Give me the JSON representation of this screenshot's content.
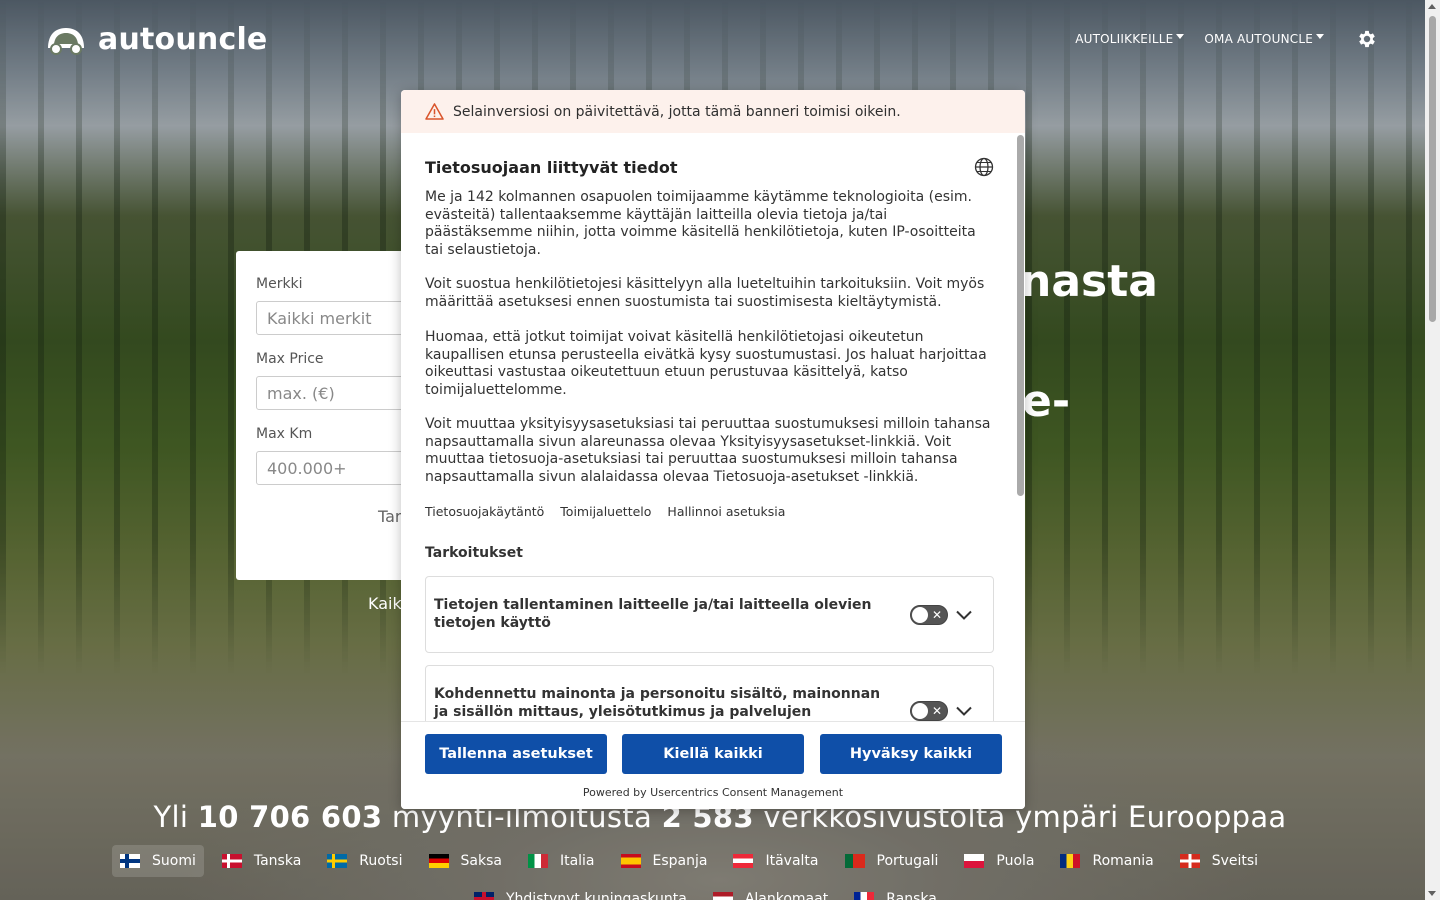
{
  "header": {
    "logo_text": "autouncle",
    "nav": [
      {
        "label": "AUTOLIIKKEILLE"
      },
      {
        "label": "OMA AUTOUNCLE"
      }
    ]
  },
  "hero": {
    "title_fragment_1": "nasta",
    "title_fragment_2": "e-"
  },
  "search": {
    "brand_label": "Merkki",
    "brand_placeholder": "Kaikki merkit",
    "price_label": "Max Price",
    "price_placeholder": "max. (€)",
    "km_label": "Max Km",
    "km_placeholder": "400.000+",
    "submit_fragment": "Tar",
    "all_link_fragment": "Kaik"
  },
  "stats": {
    "prefix": "Yli",
    "listings": "10 706 603",
    "middle": "myynti-ilmoitusta",
    "sites": "2 583",
    "suffix": "verkkosivustolta ympäri Eurooppaa"
  },
  "countries": [
    {
      "label": "Suomi",
      "flag": "fi",
      "active": true
    },
    {
      "label": "Tanska",
      "flag": "dk"
    },
    {
      "label": "Ruotsi",
      "flag": "se"
    },
    {
      "label": "Saksa",
      "flag": "de"
    },
    {
      "label": "Italia",
      "flag": "it"
    },
    {
      "label": "Espanja",
      "flag": "es"
    },
    {
      "label": "Itävalta",
      "flag": "at"
    },
    {
      "label": "Portugali",
      "flag": "pt"
    },
    {
      "label": "Puola",
      "flag": "pl"
    },
    {
      "label": "Romania",
      "flag": "ro"
    },
    {
      "label": "Sveitsi",
      "flag": "ch"
    },
    {
      "label": "Yhdistynyt kuningaskunta",
      "flag": "gb"
    },
    {
      "label": "Alankomaat",
      "flag": "nl"
    },
    {
      "label": "Ranska",
      "flag": "fr"
    }
  ],
  "consent": {
    "warning": "Selainversiosi on päivitettävä, jotta tämä banneri toimisi oikein.",
    "title": "Tietosuojaan liittyvät tiedot",
    "paragraphs": [
      "Me ja 142 kolmannen osapuolen toimijaamme käytämme teknologioita (esim. evästeitä) tallentaaksemme käyttäjän laitteilla olevia tietoja ja/tai päästäksemme niihin, jotta voimme käsitellä henkilötietoja, kuten IP-osoitteita tai selaustietoja.",
      "Voit suostua henkilötietojesi käsittelyyn alla lueteltuihin tarkoituksiin. Voit myös määrittää asetuksesi ennen suostumista tai suostimisesta kieltäytymistä.",
      "Huomaa, että jotkut toimijat voivat käsitellä henkilötietojasi oikeutetun kaupallisen etunsa perusteella eivätkä kysy suostumustasi. Jos haluat harjoittaa oikeuttasi vastustaa oikeutettuun etuun perustuvaa käsittelyä, katso toimijaluettelomme.",
      "Voit muuttaa yksityisyysasetuksiasi tai peruuttaa suostumuksesi milloin tahansa napsauttamalla sivun alareunassa olevaa Yksityisyysasetukset-linkkiä. Voit muuttaa tietosuoja-asetuksiasi tai peruuttaa suostumuksesi milloin tahansa napsauttamalla sivun alalaidassa olevaa Tietosuoja-asetukset -linkkiä."
    ],
    "links": [
      "Tietosuojakäytäntö",
      "Toimijaluettelo",
      "Hallinnoi asetuksia"
    ],
    "purposes_heading": "Tarkoitukset",
    "purposes": [
      {
        "title": "Tietojen tallentaminen laitteelle ja/tai laitteella olevien tietojen käyttö",
        "enabled": false
      },
      {
        "title": "Kohdennettu mainonta ja personoitu sisältö, mainonnan ja sisällön mittaus, yleisötutkimus ja palvelujen",
        "enabled": false
      }
    ],
    "buttons": {
      "save": "Tallenna asetukset",
      "deny": "Kiellä kaikki",
      "accept": "Hyväksy kaikki"
    },
    "powered_by": "Powered by Usercentrics Consent Management",
    "accent_color": "#0f4fa8"
  }
}
